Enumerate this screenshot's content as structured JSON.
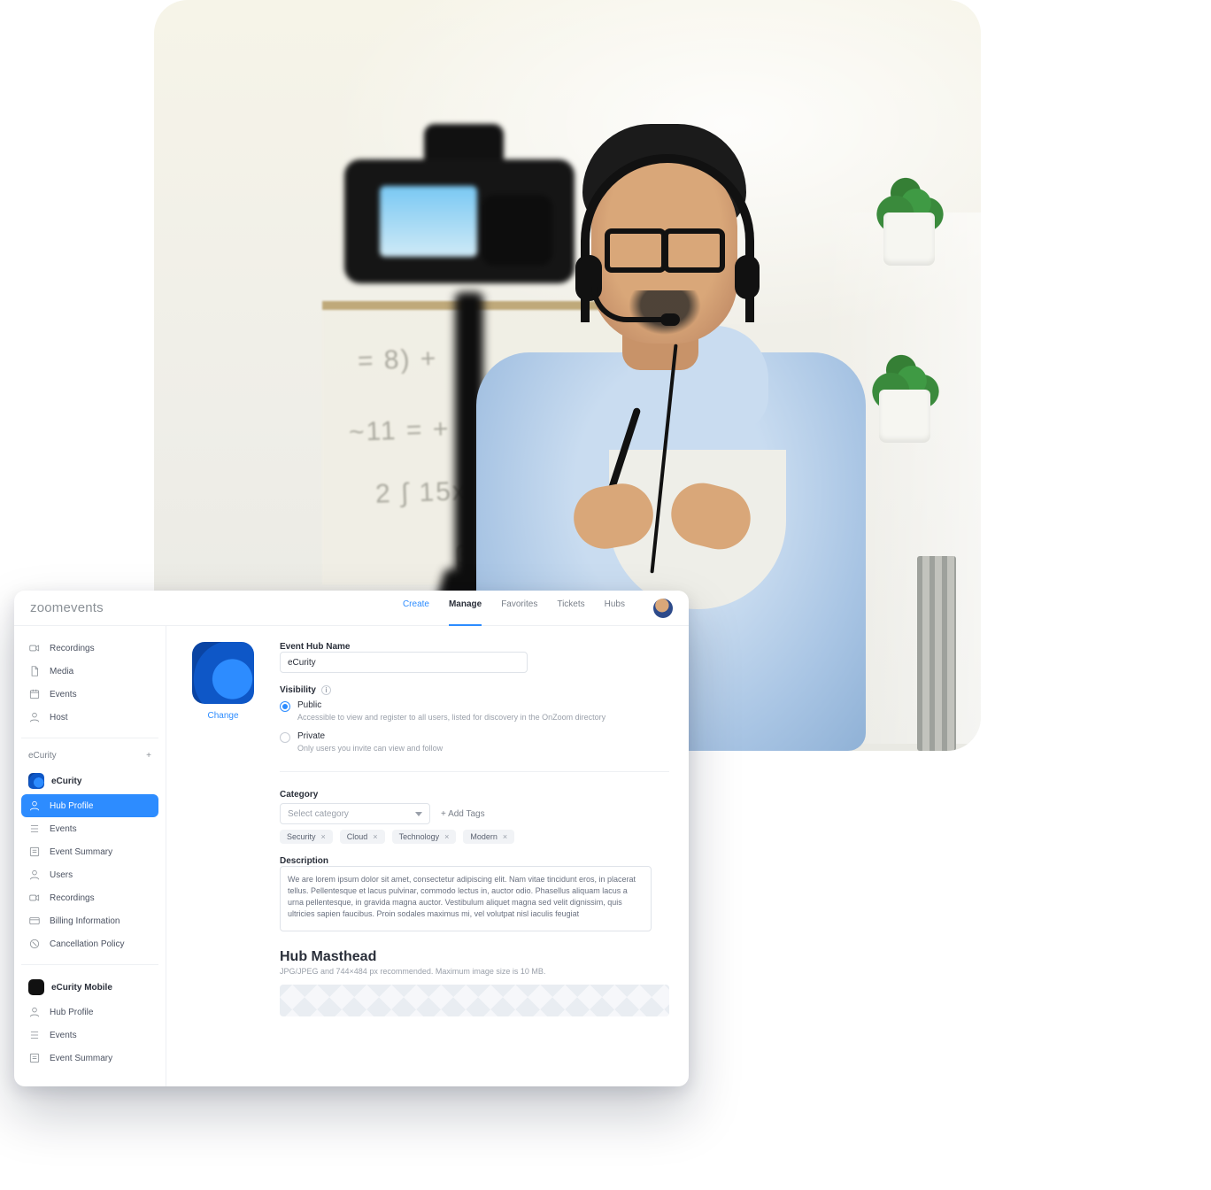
{
  "brand": {
    "name_prefix": "zoom",
    "name_suffix": "events"
  },
  "topnav": {
    "items": [
      {
        "label": "Create",
        "role": "primary"
      },
      {
        "label": "Manage",
        "role": "active"
      },
      {
        "label": "Favorites",
        "role": ""
      },
      {
        "label": "Tickets",
        "role": ""
      },
      {
        "label": "Hubs",
        "role": ""
      }
    ]
  },
  "sidebar": {
    "global": [
      {
        "icon": "camera",
        "label": "Recordings"
      },
      {
        "icon": "file",
        "label": "Media"
      },
      {
        "icon": "calendar",
        "label": "Events"
      },
      {
        "icon": "user",
        "label": "Host"
      }
    ],
    "group_header": "eCurity",
    "hub1": {
      "brand": "eCurity",
      "items": [
        {
          "icon": "user",
          "label": "Hub Profile",
          "active": true
        },
        {
          "icon": "list",
          "label": "Events"
        },
        {
          "icon": "summary",
          "label": "Event Summary"
        },
        {
          "icon": "user",
          "label": "Users"
        },
        {
          "icon": "camera",
          "label": "Recordings"
        },
        {
          "icon": "billing",
          "label": "Billing Information"
        },
        {
          "icon": "cancel",
          "label": "Cancellation Policy"
        }
      ]
    },
    "hub2": {
      "brand": "eCurity Mobile",
      "items": [
        {
          "icon": "user",
          "label": "Hub Profile"
        },
        {
          "icon": "list",
          "label": "Events"
        },
        {
          "icon": "summary",
          "label": "Event Summary"
        }
      ]
    }
  },
  "form": {
    "hub_name_label": "Event Hub Name",
    "hub_name_value": "eCurity",
    "change_label": "Change",
    "visibility_label": "Visibility",
    "public_label": "Public",
    "public_hint": "Accessible to view and register to all users, listed for discovery in the OnZoom directory",
    "private_label": "Private",
    "private_hint": "Only users you invite can view and follow",
    "category_label": "Category",
    "category_placeholder": "Select category",
    "add_tags_label": "+  Add Tags",
    "tags": [
      "Security",
      "Cloud",
      "Technology",
      "Modern"
    ],
    "description_label": "Description",
    "description_value": "We are lorem ipsum dolor sit amet, consectetur adipiscing elit. Nam vitae tincidunt eros, in placerat tellus. Pellentesque et lacus pulvinar, commodo lectus in, auctor odio. Phasellus aliquam lacus a urna pellentesque, in gravida magna auctor. Vestibulum aliquet magna sed velit dignissim, quis ultricies sapien faucibus. Proin sodales maximus mi, vel volutpat nisl iaculis feugiat",
    "masthead_title": "Hub Masthead",
    "masthead_hint": "JPG/JPEG and 744×484 px recommended. Maximum image size is 10 MB."
  }
}
